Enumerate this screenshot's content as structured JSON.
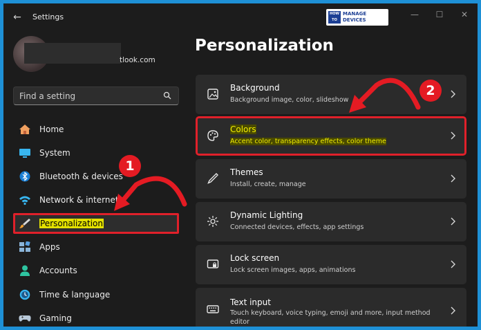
{
  "window": {
    "title": "Settings",
    "logo": {
      "line1": "HOW",
      "line2": "TO",
      "line3": "MANAGE",
      "line4": "DEVICES"
    }
  },
  "profile": {
    "email_suffix": "tlook.com"
  },
  "search": {
    "placeholder": "Find a setting"
  },
  "sidebar": {
    "items": [
      {
        "label": "Home",
        "icon": "home-icon"
      },
      {
        "label": "System",
        "icon": "system-icon"
      },
      {
        "label": "Bluetooth & devices",
        "icon": "bluetooth-icon"
      },
      {
        "label": "Network & internet",
        "icon": "wifi-icon"
      },
      {
        "label": "Personalization",
        "icon": "brush-icon",
        "active": true
      },
      {
        "label": "Apps",
        "icon": "apps-icon"
      },
      {
        "label": "Accounts",
        "icon": "accounts-icon"
      },
      {
        "label": "Time & language",
        "icon": "clock-icon"
      },
      {
        "label": "Gaming",
        "icon": "gamepad-icon"
      }
    ]
  },
  "main": {
    "title": "Personalization",
    "cards": [
      {
        "title": "Background",
        "subtitle": "Background image, color, slideshow",
        "icon": "image-icon"
      },
      {
        "title": "Colors",
        "subtitle": "Accent color, transparency effects, color theme",
        "icon": "palette-icon",
        "highlighted": true
      },
      {
        "title": "Themes",
        "subtitle": "Install, create, manage",
        "icon": "pen-icon"
      },
      {
        "title": "Dynamic Lighting",
        "subtitle": "Connected devices, effects, app settings",
        "icon": "lighting-icon"
      },
      {
        "title": "Lock screen",
        "subtitle": "Lock screen images, apps, animations",
        "icon": "lock-screen-icon"
      },
      {
        "title": "Text input",
        "subtitle": "Touch keyboard, voice typing, emoji and more, input method",
        "subtitle2": "editor",
        "icon": "keyboard-icon"
      }
    ]
  },
  "annotations": {
    "step1": "1",
    "step2": "2"
  },
  "colors": {
    "highlight_border": "#e0202a",
    "highlight_text": "#e4e100",
    "accent_blue": "#1e90d6"
  }
}
